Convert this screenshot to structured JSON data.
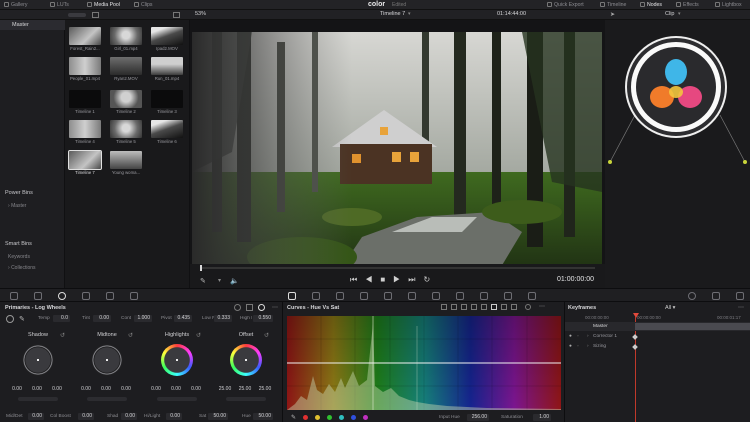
{
  "topbar": {
    "left_tabs": [
      "Gallery",
      "LUTs",
      "Media Pool",
      "Clips"
    ],
    "app_page": "color",
    "status": "Edited",
    "right_items": [
      "Quick Export",
      "Timeline",
      "Nodes",
      "Effects",
      "Lightbox"
    ]
  },
  "viewer_bar": {
    "zoom": "53%",
    "timeline_name": "Timeline 7",
    "timecode": "01:14:44:00",
    "clip_menu": "Clip"
  },
  "sidebar": {
    "master": "Master",
    "power_bins_title": "Power Bins",
    "power_bins_items": [
      "Master"
    ],
    "smart_bins_title": "Smart Bins",
    "smart_bins_items": [
      "Keywords",
      "Collections"
    ]
  },
  "media_pool": {
    "items": [
      "Forest_Rain2...",
      "Girl_01.mp4",
      "Ipad2.MOV",
      "People_01.mp4",
      "Ryan2.MOV",
      "Run_01.mp4",
      "Timeline 1",
      "Timeline 2",
      "Timeline 3",
      "Timeline 4",
      "Timeline 5",
      "Timeline 6",
      "Timeline 7",
      "Young woma..."
    ]
  },
  "transport": {
    "timecode": "01:00:00:00"
  },
  "primaries": {
    "title": "Primaries - Log Wheels",
    "top_params": [
      {
        "label": "Temp",
        "value": "0.0"
      },
      {
        "label": "Tint",
        "value": "0.00"
      },
      {
        "label": "Cont",
        "value": "1.000"
      },
      {
        "label": "Pivot",
        "value": "0.435"
      },
      {
        "label": "Low Range",
        "value": "0.333"
      },
      {
        "label": "High Range",
        "value": "0.550"
      }
    ],
    "wheels": [
      {
        "name": "Shadow",
        "values": [
          "0.00",
          "0.00",
          "0.00"
        ]
      },
      {
        "name": "Midtone",
        "values": [
          "0.00",
          "0.00",
          "0.00"
        ]
      },
      {
        "name": "Highlights",
        "values": [
          "0.00",
          "0.00",
          "0.00"
        ]
      },
      {
        "name": "Offset",
        "values": [
          "25.00",
          "25.00",
          "25.00"
        ]
      }
    ],
    "bottom_params": [
      {
        "label": "Mid/Det",
        "value": "0.00"
      },
      {
        "label": "Col Boost",
        "value": "0.00"
      },
      {
        "label": "Shad",
        "value": "0.00"
      },
      {
        "label": "Hi/Light",
        "value": "0.00"
      },
      {
        "label": "Sat",
        "value": "50.00"
      },
      {
        "label": "Hue",
        "value": "50.00"
      }
    ]
  },
  "curves": {
    "title": "Curves - Hue Vs Sat",
    "input_hue_label": "Input Hue",
    "input_hue_value": "256.00",
    "saturation_label": "Saturation",
    "saturation_value": "1.00",
    "swatch_colors": [
      "#e03030",
      "#e0c030",
      "#30c030",
      "#30c0c0",
      "#3050e0",
      "#c030c0"
    ]
  },
  "keyframes": {
    "title": "Keyframes",
    "filter": "All",
    "timecode_left": "00:00:00:00",
    "timecode_right": "00:00:01:17",
    "rows": [
      "Master",
      "Corrector 1",
      "Sizing"
    ]
  }
}
